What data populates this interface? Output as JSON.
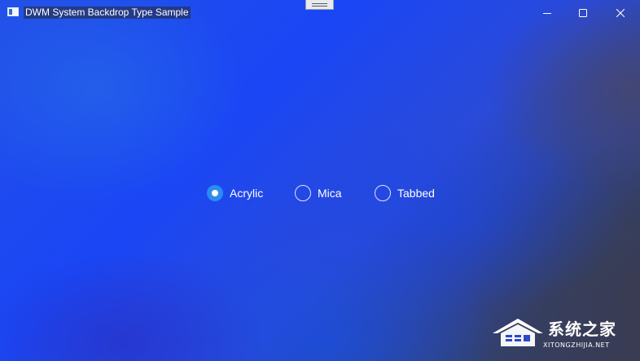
{
  "window": {
    "title": "DWM System Backdrop Type Sample",
    "caption_buttons": {
      "minimize": "minimize-icon",
      "maximize": "maximize-icon",
      "close": "close-icon"
    }
  },
  "backdrop_options": {
    "selected": "Acrylic",
    "items": [
      {
        "label": "Acrylic",
        "checked": true
      },
      {
        "label": "Mica",
        "checked": false
      },
      {
        "label": "Tabbed",
        "checked": false
      }
    ]
  },
  "watermark": {
    "brand": "系统之家",
    "url": "XITONGZHIJIA.NET"
  },
  "colors": {
    "accent": "#2a8cf0",
    "backdrop_primary": "#1a46f5",
    "backdrop_dark": "#3a3a55"
  }
}
